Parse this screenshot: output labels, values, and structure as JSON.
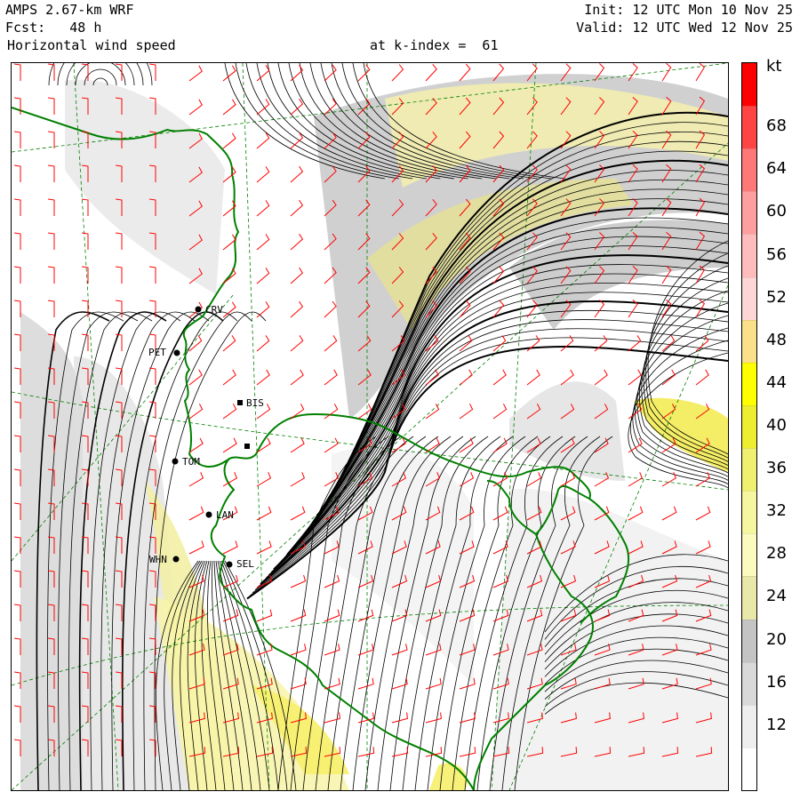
{
  "header": {
    "model": "AMPS 2.67-km WRF",
    "forecast": "Fcst:   48 h",
    "field": "Horizontal wind speed",
    "level": "at k-index =  61",
    "init": "Init: 12 UTC Mon 10 Nov 25",
    "valid": "Valid: 12 UTC Wed 12 Nov 25"
  },
  "colorbar": {
    "unit": "kt",
    "levels": [
      8,
      12,
      16,
      20,
      24,
      28,
      32,
      36,
      40,
      44,
      48,
      52,
      56,
      60,
      64,
      68,
      72
    ],
    "label_values": [
      "12",
      "16",
      "20",
      "24",
      "28",
      "32",
      "36",
      "40",
      "44",
      "48",
      "52",
      "56",
      "60",
      "64",
      "68"
    ],
    "colors": [
      "#ffffff",
      "#eeeeee",
      "#d9d9d9",
      "#c4c4c4",
      "#e8e8a8",
      "#fbfbc0",
      "#f6f6a0",
      "#f0f070",
      "#eeee30",
      "#ffff00",
      "#fbe08a",
      "#ffd6d6",
      "#ffbcbc",
      "#ff9e9e",
      "#ff7878",
      "#ff4444",
      "#ff0000"
    ]
  },
  "stations": [
    {
      "id": "CRV",
      "label": "CRV"
    },
    {
      "id": "PET",
      "label": "PET"
    },
    {
      "id": "BIS",
      "label": "BIS"
    },
    {
      "id": "TOM",
      "label": "TOM"
    },
    {
      "id": "LAN",
      "label": "LAN"
    },
    {
      "id": "WHN",
      "label": "WHN"
    },
    {
      "id": "SEL",
      "label": "SEL"
    }
  ],
  "colors": {
    "coastline": "#008000",
    "gridlines": "#008000",
    "streamlines": "#000000",
    "wind_barbs": "#ff0000"
  }
}
